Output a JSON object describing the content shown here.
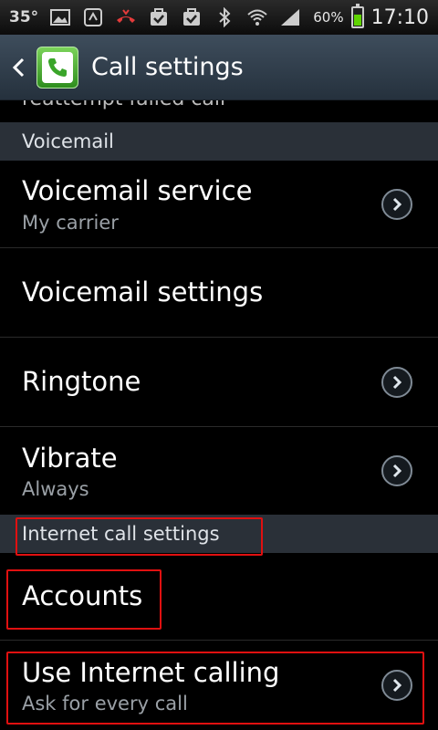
{
  "status_bar": {
    "temperature": "35°",
    "battery_percent": "60%",
    "battery_level": 0.6,
    "time": "17:10",
    "icons": [
      "image-icon",
      "voicemail-icon",
      "missed-call-icon",
      "task-icon",
      "task-icon",
      "bluetooth-icon",
      "wifi-icon",
      "signal-icon"
    ]
  },
  "titlebar": {
    "title": "Call settings",
    "app_icon": "phone-icon"
  },
  "clipped_item": "reattempt failed call",
  "sections": {
    "voicemail": "Voicemail",
    "internet": "Internet call settings"
  },
  "items": {
    "voicemail_service": {
      "title": "Voicemail service",
      "subtitle": "My carrier"
    },
    "voicemail_settings": {
      "title": "Voicemail settings"
    },
    "ringtone": {
      "title": "Ringtone"
    },
    "vibrate": {
      "title": "Vibrate",
      "subtitle": "Always"
    },
    "accounts": {
      "title": "Accounts"
    },
    "use_internet_calling": {
      "title": "Use Internet calling",
      "subtitle": "Ask for every call"
    }
  },
  "highlight_color": "#e01010"
}
